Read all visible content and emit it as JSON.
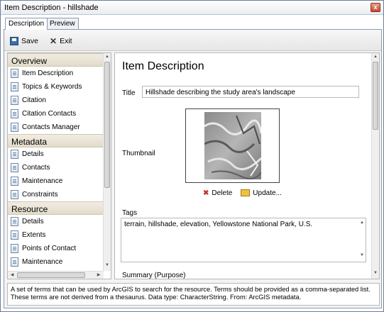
{
  "window": {
    "title": "Item Description - hillshade",
    "close_glyph": "x"
  },
  "tabs": [
    {
      "label": "Description"
    },
    {
      "label": "Preview"
    }
  ],
  "toolbar": {
    "save_label": "Save",
    "exit_label": "Exit"
  },
  "sidebar": {
    "sections": [
      {
        "header": "Overview",
        "items": [
          "Item Description",
          "Topics & Keywords",
          "Citation",
          "Citation Contacts",
          "Contacts Manager"
        ]
      },
      {
        "header": "Metadata",
        "items": [
          "Details",
          "Contacts",
          "Maintenance",
          "Constraints"
        ]
      },
      {
        "header": "Resource",
        "items": [
          "Details",
          "Extents",
          "Points of Contact",
          "Maintenance"
        ]
      }
    ]
  },
  "content": {
    "heading": "Item Description",
    "title_label": "Title",
    "title_value": "Hillshade describing the study area's landscape",
    "thumbnail_label": "Thumbnail",
    "delete_label": "Delete",
    "update_label": "Update...",
    "tags_label": "Tags",
    "tags_value": "terrain, hillshade, elevation, Yellowstone National Park, U.S.",
    "summary_label": "Summary (Purpose)"
  },
  "status_text": "A set of terms that can be used by ArcGIS to search for the resource. Terms should be provided as a comma-separated list. These terms are not derived from a thesaurus. Data type: CharacterString. From: ArcGIS metadata."
}
